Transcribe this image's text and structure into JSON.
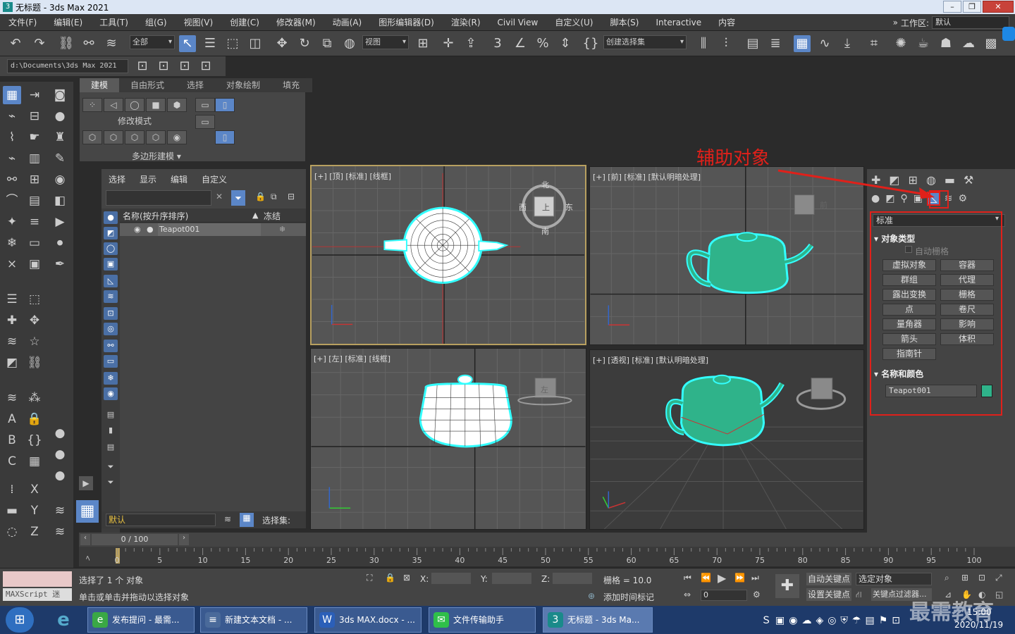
{
  "window": {
    "title": "无标题 - 3ds Max 2021",
    "logo": "3",
    "minimize": "–",
    "restore": "❐",
    "close": "✕"
  },
  "menu": [
    "文件(F)",
    "编辑(E)",
    "工具(T)",
    "组(G)",
    "视图(V)",
    "创建(C)",
    "修改器(M)",
    "动画(A)",
    "图形编辑器(D)",
    "渲染(R)",
    "Civil View",
    "自定义(U)",
    "脚本(S)",
    "Interactive",
    "内容"
  ],
  "workspace": {
    "more": "»",
    "label": "工作区:",
    "value": "默认"
  },
  "toolbar": {
    "filter": "全部",
    "refcoord": "视图",
    "named_sel": "创建选择集"
  },
  "path": "d:\\Documents\\3ds Max 2021",
  "ribbon": {
    "tabs": [
      "建模",
      "自由形式",
      "选择",
      "对象绘制",
      "填充"
    ],
    "mode": "修改模式",
    "poly": "多边形建模 ▾"
  },
  "explorer": {
    "tabs": [
      "选择",
      "显示",
      "编辑",
      "自定义"
    ],
    "col_name": "名称(按升序排序)",
    "col_sort": "▲",
    "col_freeze": "冻结",
    "row": "Teapot001",
    "layer": "默认",
    "selset": "选择集:"
  },
  "viewports": [
    {
      "label": "[+] [顶] [标准] [线框]"
    },
    {
      "label": "[+] [前] [标准] [默认明暗处理]"
    },
    {
      "label": "[+] [左] [标准] [线框]"
    },
    {
      "label": "[+] [透视] [标准] [默认明暗处理]"
    }
  ],
  "viewcube": {
    "n": "北",
    "s": "南",
    "e": "东",
    "w": "西",
    "top": "上",
    "front": "前",
    "left": "左"
  },
  "command_panel": {
    "category": "标准",
    "rollout_type": "对象类型",
    "autogrid": "自动栅格",
    "buttons": [
      "虚拟对象",
      "容器",
      "群组",
      "代理",
      "露出变换",
      "栅格",
      "点",
      "卷尺",
      "量角器",
      "影响",
      "箭头",
      "体积",
      "指南针"
    ],
    "rollout_name": "名称和颜色",
    "object_name": "Teapot001",
    "object_color": "#2fb38a"
  },
  "annotation": "辅助对象",
  "time": {
    "frame": "0 / 100",
    "ticks": [
      "0",
      "5",
      "10",
      "15",
      "20",
      "25",
      "30",
      "35",
      "40",
      "45",
      "50",
      "55",
      "60",
      "65",
      "70",
      "75",
      "80",
      "85",
      "90",
      "95",
      "100"
    ]
  },
  "status": {
    "selected": "选择了 1 个 对象",
    "prompt": "单击或单击并拖动以选择对象",
    "maxscript": "MAXScript 迷",
    "x": "X:",
    "y": "Y:",
    "z": "Z:",
    "grid": "栅格 = 10.0",
    "add_tag": "添加时间标记",
    "autokey": "自动关键点",
    "selected_obj": "选定对象",
    "setkey": "设置关键点",
    "keyfilter": "关键点过滤器...",
    "frame_field": "0"
  },
  "taskbar": [
    {
      "label": "发布提问 - 最需...",
      "color": "#3aa845",
      "glyph": "e"
    },
    {
      "label": "新建文本文档 - ...",
      "color": "#4a6a9a",
      "glyph": "≡"
    },
    {
      "label": "3ds MAX.docx - ...",
      "color": "#2b5fb8",
      "glyph": "W"
    },
    {
      "label": "文件传输助手",
      "color": "#2fbf4a",
      "glyph": "✉"
    },
    {
      "label": "无标题 - 3ds Ma...",
      "color": "#1a8a8a",
      "glyph": "3"
    }
  ],
  "clock": {
    "time": "15:00",
    "date": "2020/11/19"
  },
  "watermark": "最需教育"
}
